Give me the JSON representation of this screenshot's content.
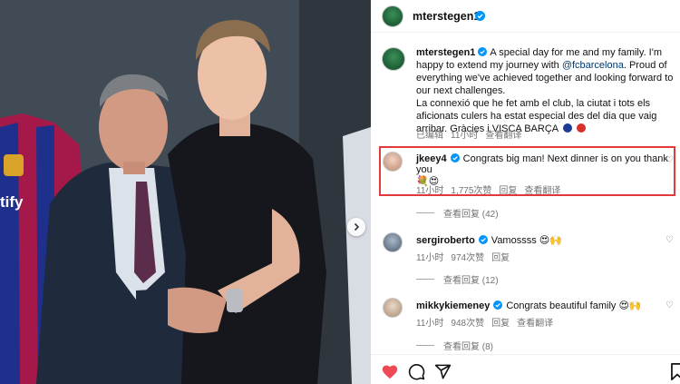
{
  "post": {
    "username": "mterstegen1",
    "caption_username": "mterstegen1",
    "caption_part1": "A special day for me and my family. I'm happy to extend my journey with ",
    "caption_mention": "@fcbarcelona",
    "caption_part2": ". Proud of everything we've achieved together and looking forward to our next challenges.",
    "caption_part3": "La connexió que he fet amb el club, la ciutat i tots els aficionats culers ha estat especial des del dia que vaig arribar. Gràcies i VISCA BARÇA",
    "edited": "已编辑",
    "time": "11小时",
    "translate": "查看翻译"
  },
  "comments": [
    {
      "username": "jkeey4",
      "text": "Congrats big man! Next dinner is on you thank you",
      "emoji": "💐😍",
      "time": "11小时",
      "likes": "1,775次赞",
      "reply": "回复",
      "translate": "查看翻译",
      "view_replies": "查看回复 (42)",
      "highlighted": true
    },
    {
      "username": "sergiroberto",
      "text": "Vamossss",
      "emoji": "😍🙌",
      "time": "11小时",
      "likes": "974次赞",
      "reply": "回复",
      "translate": "",
      "view_replies": "查看回复 (12)"
    },
    {
      "username": "mikkykiemeney",
      "text": "Congrats beautiful family",
      "emoji": "😍🙌",
      "time": "11小时",
      "likes": "948次赞",
      "reply": "回复",
      "translate": "查看翻译",
      "view_replies": "查看回复 (8)"
    }
  ],
  "photo": {
    "sponsor_text": "tify",
    "icons": {
      "next": "chevron-right-icon"
    }
  },
  "actions": {
    "icons": [
      "heart-filled-icon",
      "comment-icon",
      "share-icon",
      "bookmark-icon"
    ]
  },
  "colors": {
    "accent_red": "#ed4956",
    "verified_blue": "#0095f6",
    "mention": "#00376b",
    "highlight_border": "#e23a3a"
  }
}
